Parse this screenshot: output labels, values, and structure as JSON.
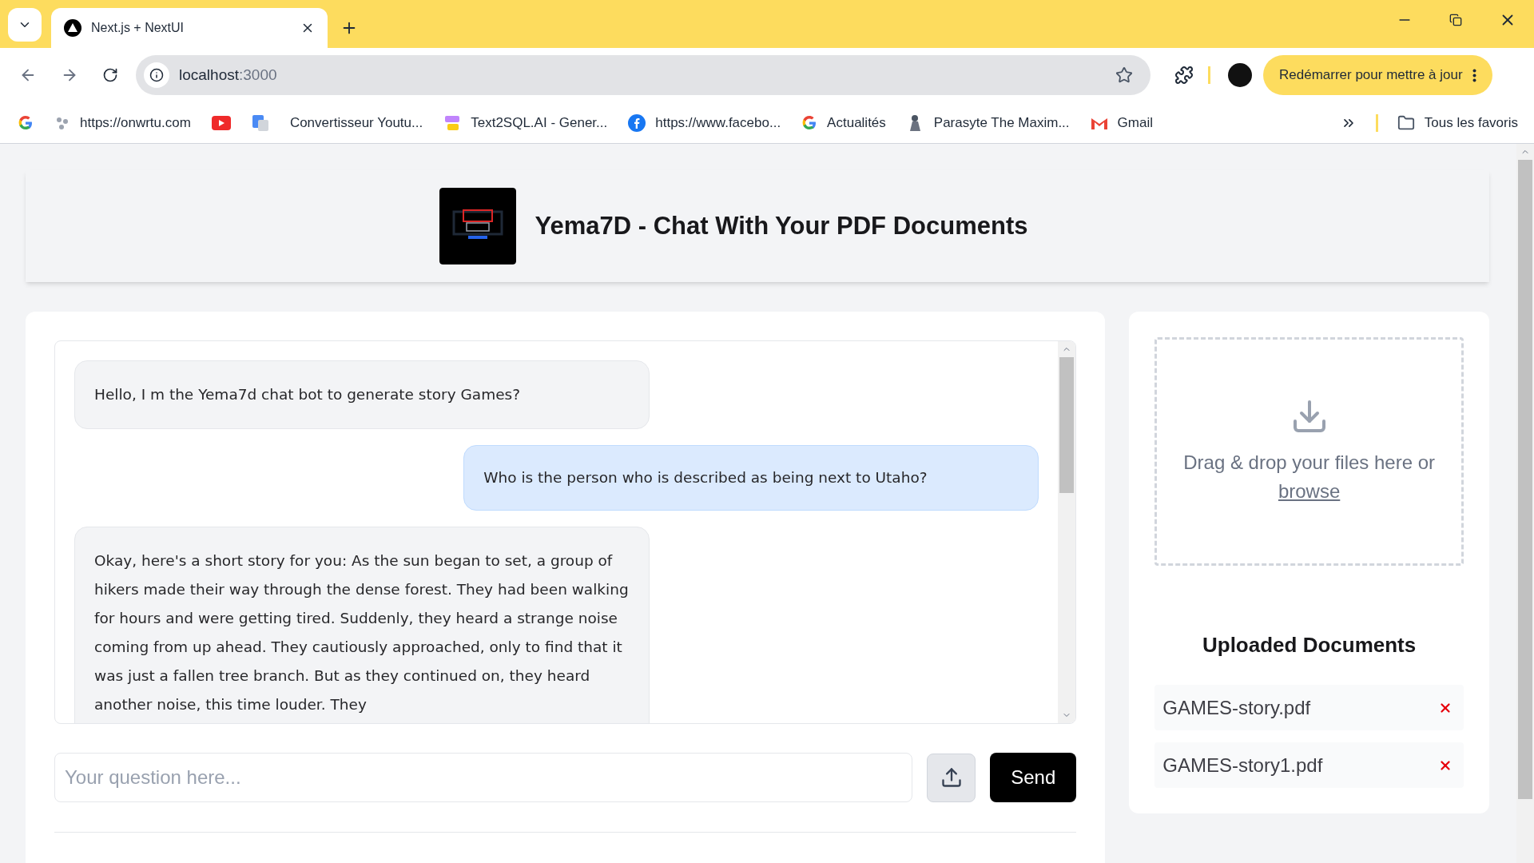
{
  "browser": {
    "tabs": [
      {
        "title": "Next.js + NextUI",
        "selected": true
      }
    ],
    "address": {
      "host": "localhost",
      "port": ":3000"
    },
    "update_button": "Redémarrer pour mettre à jour",
    "bookmarks": [
      {
        "kind": "google"
      },
      {
        "kind": "generic",
        "label": "https://onwrtu.com"
      },
      {
        "kind": "video"
      },
      {
        "kind": "translate"
      },
      {
        "kind": "blank",
        "label": "Convertisseur Youtu..."
      },
      {
        "kind": "sql",
        "label": "Text2SQL.AI - Gener..."
      },
      {
        "kind": "facebook",
        "label": "https://www.facebo..."
      },
      {
        "kind": "google",
        "label": "Actualités"
      },
      {
        "kind": "figure",
        "label": "Parasyte The Maxim..."
      },
      {
        "kind": "mail",
        "label": "Gmail"
      }
    ],
    "all_bookmarks": "Tous les favoris"
  },
  "header": {
    "title": "Yema7D - Chat With Your PDF Documents"
  },
  "chat": {
    "messages": [
      {
        "kind": "bot",
        "text": "Hello, I m the Yema7d chat bot to generate story Games?"
      },
      {
        "kind": "user",
        "text": "Who is the person who is described as being next to Utaho?"
      },
      {
        "kind": "bot",
        "text": "Okay, here's a short story for you: As the sun began to set, a group of hikers made their way through the dense forest. They had been walking for hours and were getting tired. Suddenly, they heard a strange noise coming from up ahead. They cautiously approached, only to find that it was just a fallen tree branch. But as they continued on, they heard another noise, this time louder. They"
      }
    ],
    "input": {
      "placeholder": "Your question here..."
    },
    "send_button": "Send"
  },
  "uploads": {
    "dropzone_text": "Drag & drop your files here or",
    "browse_link": "browse",
    "heading": "Uploaded Documents",
    "documents": [
      {
        "name": "GAMES-story.pdf"
      },
      {
        "name": "GAMES-story1.pdf"
      }
    ]
  }
}
